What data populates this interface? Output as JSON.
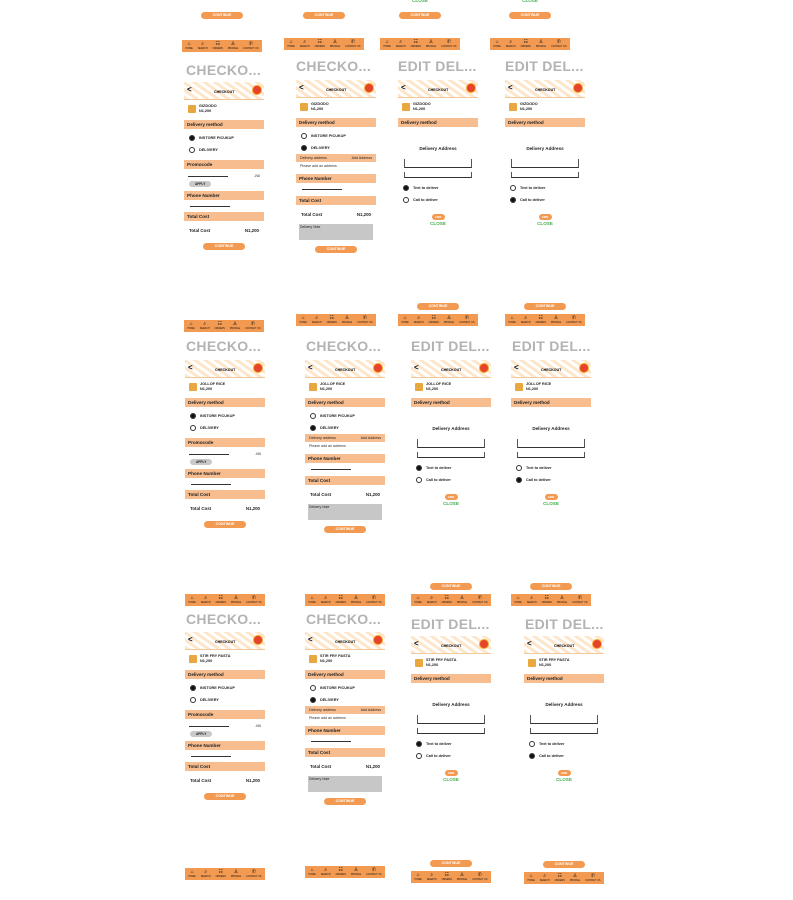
{
  "labels": {
    "checkout_title": "CHECKO...",
    "edit_title": "EDIT DEL...",
    "screen_header": "CHECKOUT",
    "delivery_method": "Delivery method",
    "instore": "INSTORE PICUKUP",
    "delivery": "DELIVERY",
    "promocode": "Promocode",
    "promo_value": "-N0",
    "apply": "APPLY",
    "phone_number": "Phone Number",
    "total_cost": "Total Cost",
    "total_label": "Total Cost",
    "delivery_address": "Delivery address",
    "add_address": "Add Address",
    "please_add": "Please add an address",
    "delivery_note": "Delivery Note",
    "continue": "CONTINUE",
    "modal_title": "Delivery Address",
    "text_deliver": "Text to deliver",
    "call_deliver": "Call to deliver",
    "add": "ADD",
    "close": "CLOSE"
  },
  "nav": [
    "HOME",
    "SEARCH",
    "ORDERS",
    "PROFILE",
    "CONTACT US"
  ],
  "nav_icons": [
    "home-icon",
    "search-icon",
    "orders-icon",
    "profile-icon",
    "phone-icon"
  ],
  "rows": [
    {
      "item": "GIZDODO",
      "price": "N1,200",
      "total": "N1,200"
    },
    {
      "item": "JOLLOF RICE",
      "price": "N1,200",
      "total": "N1,200"
    },
    {
      "item": "STIR FRY PASTA",
      "price": "N1,200",
      "total": "N1,200"
    }
  ],
  "colors": {
    "accent": "#f39a52",
    "section": "#f8bd8e",
    "close": "#3fae4a",
    "title_gray": "#b3b3b3"
  }
}
